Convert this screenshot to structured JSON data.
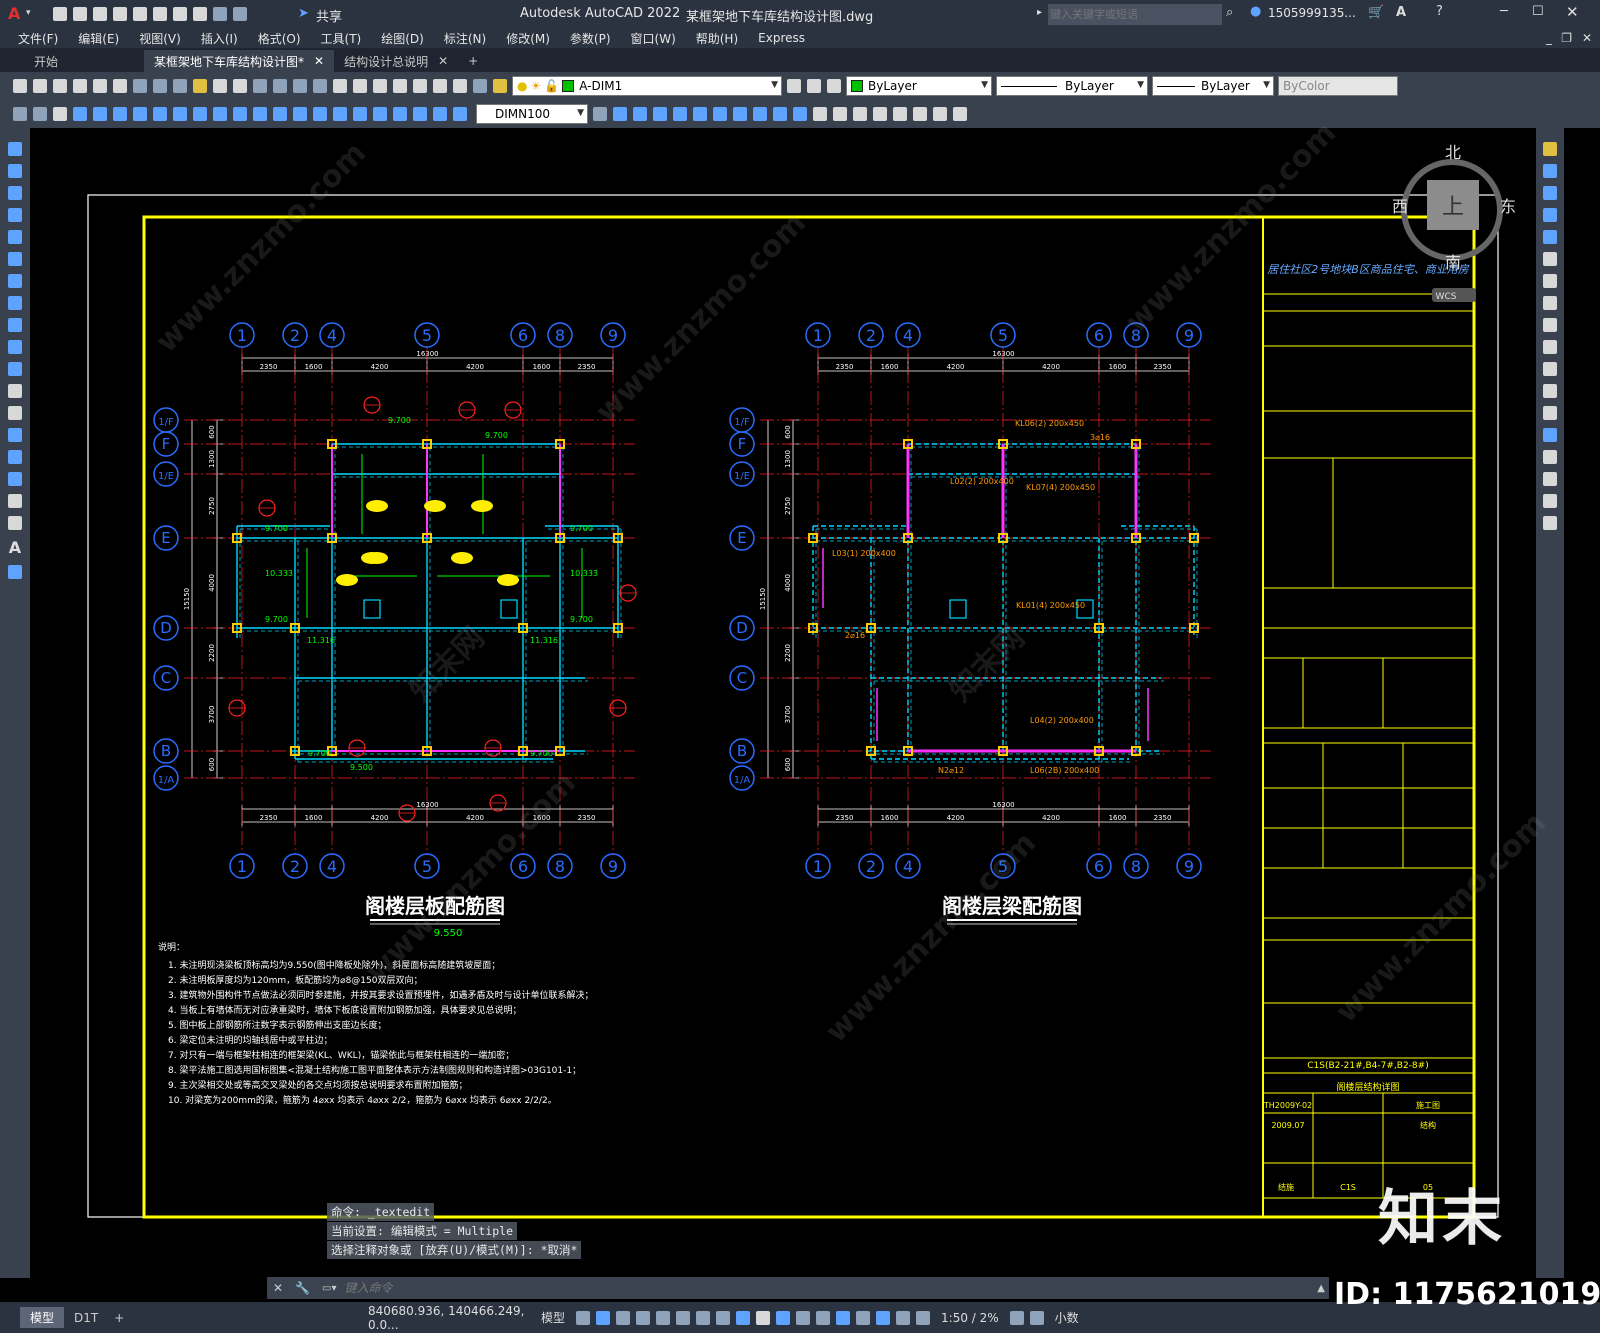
{
  "titlebar": {
    "app_icon": "A",
    "share_label": "共享",
    "app_name": "Autodesk AutoCAD 2022",
    "file_name": "某框架地下车库结构设计图.dwg",
    "search_placeholder": "键入关键字或短语",
    "user": "1505999135...",
    "icons": [
      "new-icon",
      "open-icon",
      "save-icon",
      "saveas-icon",
      "plot-icon",
      "undo-icon",
      "redo-icon",
      "share-icon",
      "search-icon",
      "user-icon",
      "cart-icon",
      "help-icon",
      "minimize-icon",
      "maximize-icon",
      "close-icon"
    ]
  },
  "menu": [
    "文件(F)",
    "编辑(E)",
    "视图(V)",
    "插入(I)",
    "格式(O)",
    "工具(T)",
    "绘图(D)",
    "标注(N)",
    "修改(M)",
    "参数(P)",
    "窗口(W)",
    "帮助(H)",
    "Express"
  ],
  "tabs": [
    {
      "label": "开始",
      "closable": false
    },
    {
      "label": "某框架地下车库结构设计图*",
      "closable": true,
      "active": true
    },
    {
      "label": "结构设计总说明",
      "closable": true
    }
  ],
  "toolbar1": {
    "layer": "A-DIM1",
    "color": "ByLayer",
    "linetype": "ByLayer",
    "lineweight": "ByLayer",
    "plotstyle": "ByColor",
    "layer_color": "#00c000"
  },
  "toolbar2": {
    "dimstyle": "DIMN100"
  },
  "viewcube": {
    "north": "北",
    "south": "南",
    "east": "东",
    "west": "西",
    "top": "上",
    "wcs": "WCS"
  },
  "drawing": {
    "axes_top": [
      "1",
      "2",
      "4",
      "5",
      "6",
      "8",
      "9"
    ],
    "axes_left": [
      "1/F",
      "F",
      "1/E",
      "E",
      "D",
      "C",
      "B",
      "1/A"
    ],
    "dims_top": [
      "2350",
      "1600",
      "4200",
      "4200",
      "1600",
      "2350"
    ],
    "total_width": "16300",
    "dims_left": [
      "600",
      "1300",
      "2750",
      "4000",
      "2200",
      "3700",
      "600"
    ],
    "total_height": "15150",
    "slab_title": "阁楼层板配筋图",
    "slab_elev": "9.550",
    "beam_title": "阁楼层梁配筋图",
    "slab_level_labels": [
      "9.700",
      "9.700",
      "9.700",
      "9.700",
      "10.333",
      "10.333",
      "9.700",
      "9.700",
      "11.316",
      "11.316",
      "9.700",
      "9.700",
      "9.500"
    ],
    "beam_labels": [
      "KL06(2) 200x450",
      "KL07(4) 200x450",
      "L02(2) 200x400",
      "L03(1) 200x400",
      "KL01(4) 200x450",
      "L04(2) 200x400",
      "L06(2B) 200x400",
      "3⌀16",
      "2⌀16",
      "N2⌀12"
    ],
    "notes_title": "说明：",
    "notes": [
      "1. 未注明现浇梁板顶标高均为9.550(图中降板处除外)，斜屋面标高随建筑坡屋面；",
      "2. 未注明板厚度均为120mm，板配筋均为⌀8@150双层双向；",
      "3. 建筑物外围构件节点做法必须同时参建施，并按其要求设置预埋件，如遇矛盾及时与设计单位联系解决；",
      "4. 当板上有墙体而无对应承重梁时，墙体下板底设置附加钢筋加强，具体要求见总说明；",
      "5. 图中板上部钢筋所注数字表示钢筋伸出支座边长度；",
      "6. 梁定位未注明的均轴线居中或平柱边；",
      "7. 对只有一端与框架柱相连的框架梁(KL、WKL)，锚梁依此与框架柱相连的一端加密；",
      "8. 梁平法施工图选用国标图集<混凝土结构施工图平面整体表示方法制图规则和构造详图>03G101-1；",
      "9. 主次梁相交处或等高交叉梁处的各交点均须按总说明要求布置附加箍筋；",
      "10. 对梁宽为200mm的梁，箍筋为 4⌀xx 均表示 4⌀xx 2/2，箍筋为 6⌀xx 均表示 6⌀xx 2/2/2。"
    ],
    "titleblock": {
      "project": "居住社区2号地块B区商品住宅、商业用房",
      "drawing_code": "C1S(B2-21#,B4-7#,B2-8#)",
      "drawing_name": "阁楼层结构详图",
      "number": "TH2009Y-02",
      "stage": "施工图",
      "date": "2009.07",
      "sheet_type": "结构",
      "set": "C1S",
      "sheet_no": "05",
      "discipline": "结施"
    }
  },
  "command": {
    "history": [
      "命令: _textedit",
      "当前设置: 编辑模式 = Multiple",
      "选择注释对象或 [放弃(U)/模式(M)]: *取消*"
    ],
    "placeholder": "键入命令"
  },
  "layout_tabs": [
    "模型",
    "D1T"
  ],
  "status": {
    "coords": "840680.936, 140466.249, 0.0...",
    "model": "模型",
    "scale": "1:50 / 2%",
    "units": "小数"
  },
  "watermarks": [
    "www.znzmo.com",
    "知末网"
  ],
  "brand": {
    "logo": "知末",
    "id": "ID: 1175621019"
  }
}
